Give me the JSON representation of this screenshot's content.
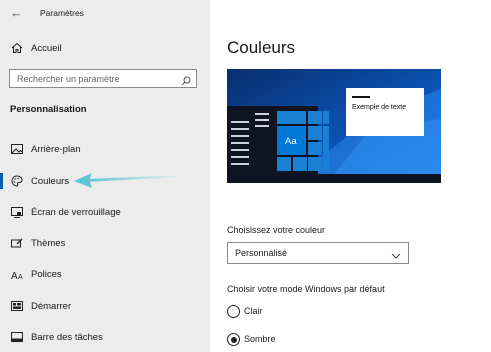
{
  "window": {
    "title": "Paramètres"
  },
  "sidebar": {
    "home_label": "Accueil",
    "search_placeholder": "Rechercher un paramètre",
    "section_title": "Personnalisation",
    "items": [
      {
        "label": "Arrière-plan",
        "icon": "image-icon"
      },
      {
        "label": "Couleurs",
        "icon": "palette-icon",
        "selected": true
      },
      {
        "label": "Écran de verrouillage",
        "icon": "lock-screen-icon"
      },
      {
        "label": "Thèmes",
        "icon": "themes-icon"
      },
      {
        "label": "Polices",
        "icon": "font-icon"
      },
      {
        "label": "Démarrer",
        "icon": "start-icon"
      },
      {
        "label": "Barre des tâches",
        "icon": "taskbar-icon"
      }
    ]
  },
  "main": {
    "title": "Couleurs",
    "preview": {
      "tile_text": "Aa",
      "sample_text": "Exemple de texte"
    },
    "color_choice": {
      "label": "Choisissez votre couleur",
      "value": "Personnalisé"
    },
    "mode": {
      "label": "Choisir votre mode Windows par défaut",
      "options": [
        {
          "label": "Clair",
          "selected": false
        },
        {
          "label": "Sombre",
          "selected": true
        }
      ]
    }
  },
  "colors": {
    "accent": "#0063b1",
    "sidebar_bg": "#ececec",
    "annotation_arrow": "#5fc6d6"
  }
}
